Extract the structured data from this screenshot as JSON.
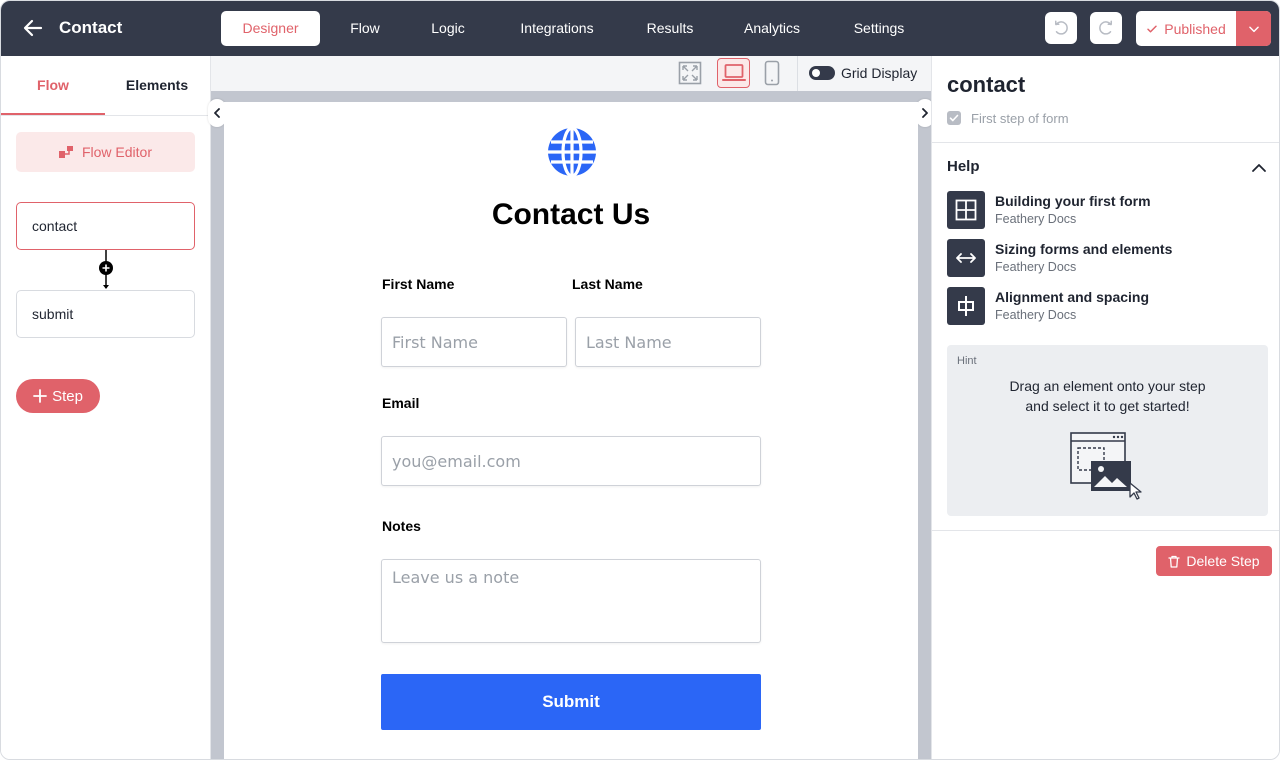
{
  "app": {
    "title": "Contact"
  },
  "nav": {
    "tabs": [
      {
        "label": "Designer",
        "active": true
      },
      {
        "label": "Flow"
      },
      {
        "label": "Logic"
      },
      {
        "label": "Integrations"
      },
      {
        "label": "Results"
      },
      {
        "label": "Analytics"
      },
      {
        "label": "Settings"
      }
    ],
    "publish_label": "Published"
  },
  "left_panel": {
    "tabs": [
      {
        "label": "Flow",
        "active": true
      },
      {
        "label": "Elements"
      }
    ],
    "flow_editor_label": "Flow Editor",
    "steps": [
      {
        "label": "contact",
        "active": true
      },
      {
        "label": "submit"
      }
    ],
    "add_step_label": "Step"
  },
  "canvas": {
    "viewport_modes": [
      "fullscreen",
      "desktop",
      "mobile"
    ],
    "selected_viewport": "desktop",
    "grid_display_label": "Grid Display",
    "grid_display_on": false
  },
  "form": {
    "title": "Contact Us",
    "first_name": {
      "label": "First Name",
      "placeholder": "First Name"
    },
    "last_name": {
      "label": "Last Name",
      "placeholder": "Last Name"
    },
    "email": {
      "label": "Email",
      "placeholder": "you@email.com"
    },
    "notes": {
      "label": "Notes",
      "placeholder": "Leave us a note"
    },
    "submit_label": "Submit"
  },
  "right_panel": {
    "step_name": "contact",
    "first_step_label": "First step of form",
    "first_step_checked": true,
    "help_title": "Help",
    "help_items": [
      {
        "title": "Building your first form",
        "source": "Feathery Docs",
        "icon": "layout-icon"
      },
      {
        "title": "Sizing forms and elements",
        "source": "Feathery Docs",
        "icon": "resize-icon"
      },
      {
        "title": "Alignment and spacing",
        "source": "Feathery Docs",
        "icon": "align-icon"
      }
    ],
    "hint_label": "Hint",
    "hint_line1": "Drag an element onto your step",
    "hint_line2": "and select it to get started!",
    "delete_label": "Delete Step"
  },
  "colors": {
    "topbar": "#343a4a",
    "accent": "#e0626a",
    "submit_button": "#2b66f6",
    "globe": "#2b66f6"
  }
}
